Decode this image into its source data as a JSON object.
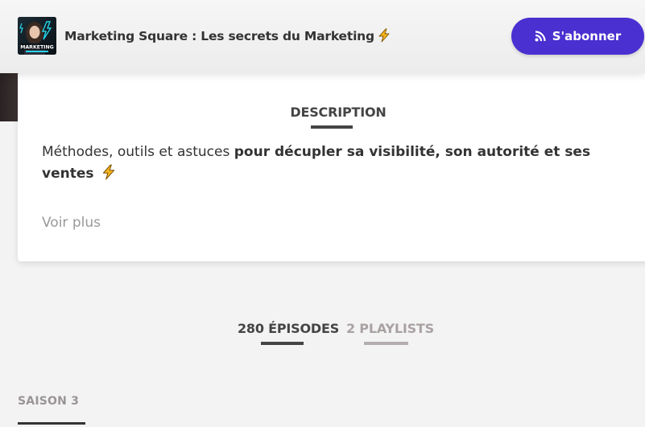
{
  "header": {
    "cover_text": "MARKETING",
    "podcast_title": "Marketing Square : Les secrets du Marketing",
    "title_icon": "lightning-bolt-icon",
    "subscribe_label": "S'abonner",
    "subscribe_icon": "rss-icon",
    "accent_color": "#4a2fd1"
  },
  "description": {
    "heading": "DESCRIPTION",
    "text_plain": "Méthodes, outils et astuces ",
    "text_bold": "pour décupler sa visibilité, son autorité et ses ventes",
    "text_icon": "lightning-bolt-icon",
    "see_more": "Voir plus"
  },
  "tabs": [
    {
      "label": "280 ÉPISODES",
      "active": true
    },
    {
      "label": "2 PLAYLISTS",
      "active": false
    }
  ],
  "season": {
    "label": "SAISON 3"
  }
}
